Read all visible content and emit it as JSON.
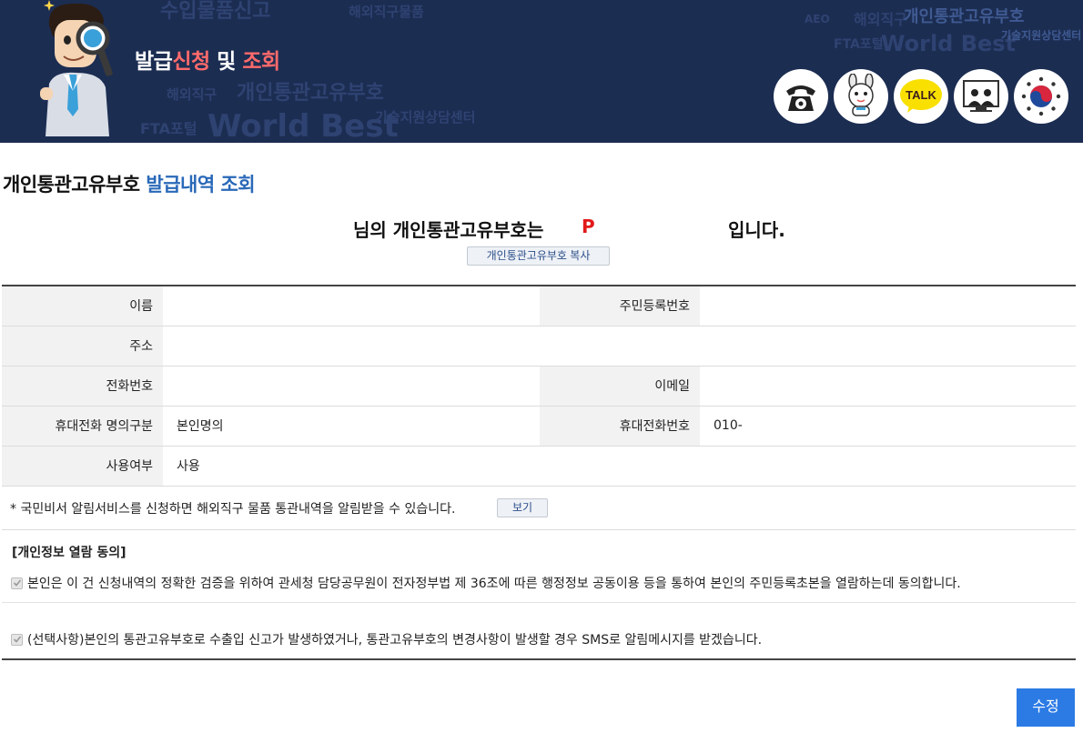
{
  "banner": {
    "title_part1": "발급",
    "title_part2": "신청",
    "title_part3": " 및 ",
    "title_part4": "조회",
    "bg_words": [
      "수입물품신고",
      "해외직구물품",
      "개인통관고유부호",
      "World Best",
      "기술지원상담센터",
      "FTA포털",
      "해외직구",
      "AEO",
      "해외직구",
      "개인통관고유부호",
      "World Best",
      "기술지원상담센터",
      "FTA포털"
    ],
    "icons": [
      "phone-icon",
      "mascot-chat-icon",
      "kakao-talk-icon",
      "remote-support-icon",
      "government-emblem-icon"
    ],
    "kakao_label": "TALK"
  },
  "section": {
    "title_black": "개인통관고유부호 ",
    "title_blue": "발급내역 조회"
  },
  "result": {
    "prefix": "님의 개인통관고유부호는",
    "code": "P",
    "suffix": "입니다.",
    "copy_button": "개인통관고유부호 복사"
  },
  "table": {
    "name_label": "이름",
    "name_value": "",
    "rrn_label": "주민등록번호",
    "rrn_value": "",
    "address_label": "주소",
    "address_value": "",
    "phone_label": "전화번호",
    "phone_value": "",
    "email_label": "이메일",
    "email_value": "",
    "mobile_owner_label": "휴대전화 명의구분",
    "mobile_owner_value": "본인명의",
    "mobile_label": "휴대전화번호",
    "mobile_value": "010-",
    "usage_label": "사용여부",
    "usage_value": "사용"
  },
  "notice": {
    "text": "* 국민비서 알림서비스를 신청하면 해외직구 물품 통관내역을 알림받을 수 있습니다.",
    "view_button": "보기"
  },
  "consent": {
    "heading": "[개인정보 열람 동의]",
    "item1": "본인은 이 건 신청내역의 정확한 검증을 위하여 관세청 담당공무원이 전자정부법 제 36조에 따른 행정정보 공동이용 등을 통하여 본인의 주민등록초본을 열람하는데 동의합니다.",
    "item2": "(선택사항)본인의 통관고유부호로 수출입 신고가 발생하였거나, 통관고유부호의 변경사항이 발생할 경우 SMS로 알림메시지를 받겠습니다.",
    "item1_checked": true,
    "item2_checked": true
  },
  "actions": {
    "edit_button": "수정"
  },
  "colors": {
    "banner_bg": "#1c2d52",
    "accent_red": "#ff6b6b",
    "title_blue": "#2a69b8",
    "code_red": "#e21a1a",
    "edit_button": "#2c7be5"
  }
}
